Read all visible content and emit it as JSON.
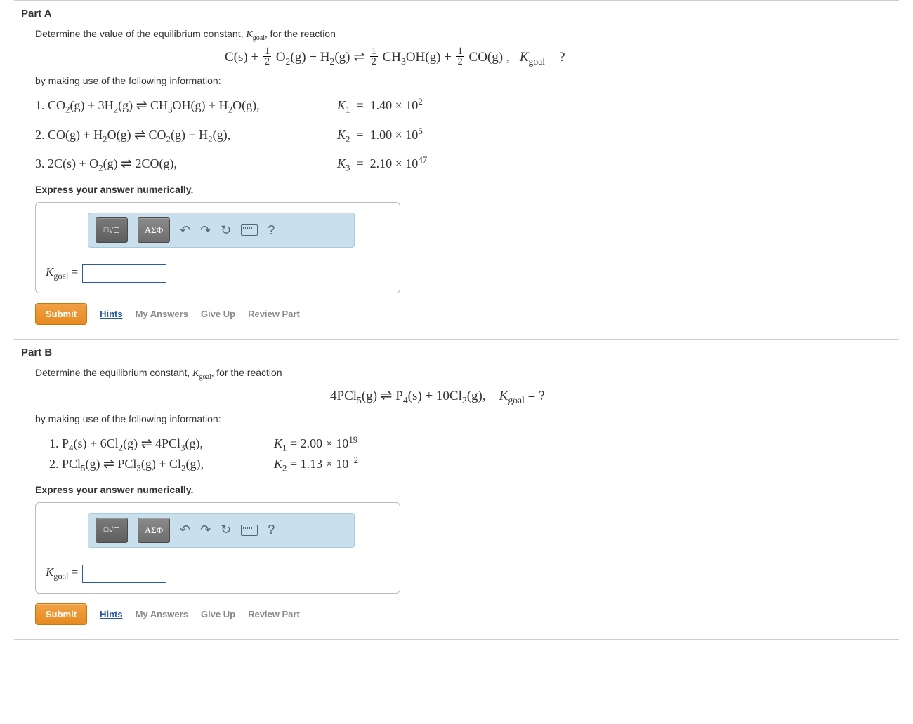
{
  "partA": {
    "title": "Part A",
    "intro1_pre": "Determine the value of the equilibrium constant, ",
    "intro1_post": " for the reaction",
    "kgoal_sym_pre": "K",
    "kgoal_sym_sub": "goal",
    "kgoal_sym_post": ",",
    "intro2": "by making use of the following information:",
    "instruction": "Express your answer numerically.",
    "answer_label_pre": "K",
    "answer_label_sub": "goal",
    "answer_label_eq": " =",
    "k1_val": "1.40 × 10",
    "k1_exp": "2",
    "k2_val": "1.00 × 10",
    "k2_exp": "5",
    "k3_val": "2.10 × 10",
    "k3_exp": "47"
  },
  "partB": {
    "title": "Part B",
    "intro1_pre": "Determine the equilibrium constant, ",
    "intro1_post": " for the reaction",
    "kgoal_sym_pre": "K",
    "kgoal_sym_sub": "goal",
    "kgoal_sym_post": ",",
    "intro2": "by making use of the following information:",
    "instruction": "Express your answer numerically.",
    "answer_label_pre": "K",
    "answer_label_sub": "goal",
    "answer_label_eq": " =",
    "k1_val": "2.00 × 10",
    "k1_exp": "19",
    "k2_val": "1.13 × 10",
    "k2_exp": "−2"
  },
  "toolbar": {
    "btn1": "√☐",
    "btn2": "ΑΣΦ",
    "undo": "↶",
    "redo": "↷",
    "reset": "↻",
    "help": "?"
  },
  "buttons": {
    "submit": "Submit",
    "hints": "Hints",
    "myanswers": "My Answers",
    "giveup": "Give Up",
    "review": "Review Part"
  }
}
